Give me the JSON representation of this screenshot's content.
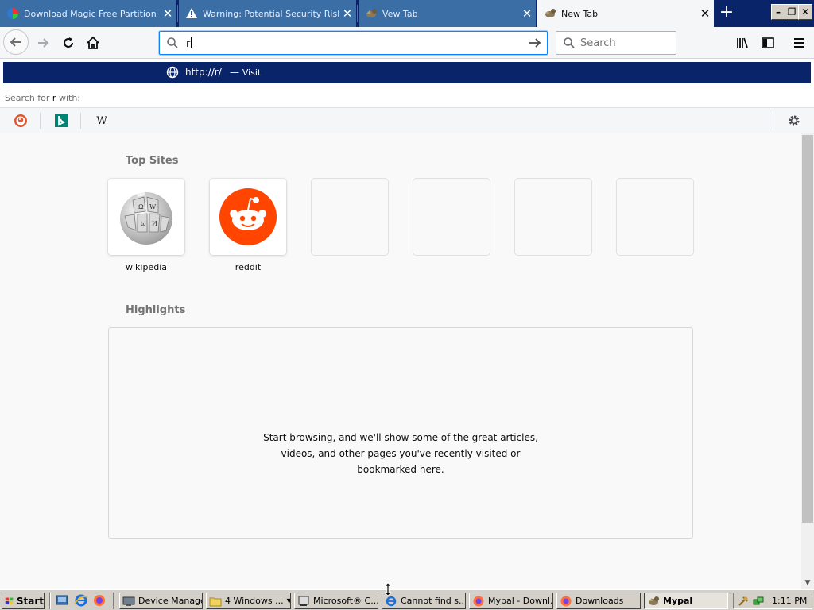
{
  "tabs": [
    {
      "label": "Download Magic Free Partition Ma",
      "close": "✕"
    },
    {
      "label": "Warning: Potential Security Risk A",
      "close": "✕"
    },
    {
      "label": "Vew Tab",
      "close": "✕"
    },
    {
      "label": "New Tab",
      "close": "✕"
    }
  ],
  "new_tab_label": "+",
  "window_controls": {
    "minimize": "–",
    "restore": "❐",
    "close": "✕"
  },
  "urlbar": {
    "value": "r"
  },
  "searchbar": {
    "placeholder": "Search"
  },
  "dropdown": {
    "suggestion_url": "http://r/",
    "suggestion_dash": "—",
    "suggestion_action": "Visit",
    "search_for_prefix": "Search for",
    "search_for_term": "r",
    "search_for_suffix": "with:",
    "engines": [
      "duckduckgo-icon",
      "bing-icon",
      "wikipedia-icon"
    ],
    "wikipedia_letter": "W"
  },
  "top_sites": {
    "title": "Top Sites",
    "sites": [
      {
        "label": "wikipedia",
        "icon": "wikipedia-logo-icon"
      },
      {
        "label": "reddit",
        "icon": "reddit-logo-icon"
      }
    ],
    "empty_slots": 4
  },
  "highlights": {
    "title": "Highlights",
    "empty_message": "Start browsing, and we'll show some of the great articles, videos, and other pages you've recently visited or bookmarked here."
  },
  "taskbar": {
    "start_label": "Start",
    "tasks": [
      {
        "label": "Device Manager"
      },
      {
        "label": "4 Windows ..."
      },
      {
        "label": "Microsoft® C..."
      },
      {
        "label": "Cannot find s..."
      },
      {
        "label": "Mypal - Downl..."
      },
      {
        "label": "Downloads"
      },
      {
        "label": "Mypal",
        "active": true
      }
    ],
    "clock": "1:11 PM"
  },
  "colors": {
    "titlebar": "#0a246a",
    "inactive_tab": "#3a6ea5",
    "active_tab": "#f5f6f7",
    "suggestion_highlight": "#0a246a",
    "focus_ring": "#0a84ff",
    "reddit": "#ff4500",
    "taskbar": "#d4d0c8"
  }
}
